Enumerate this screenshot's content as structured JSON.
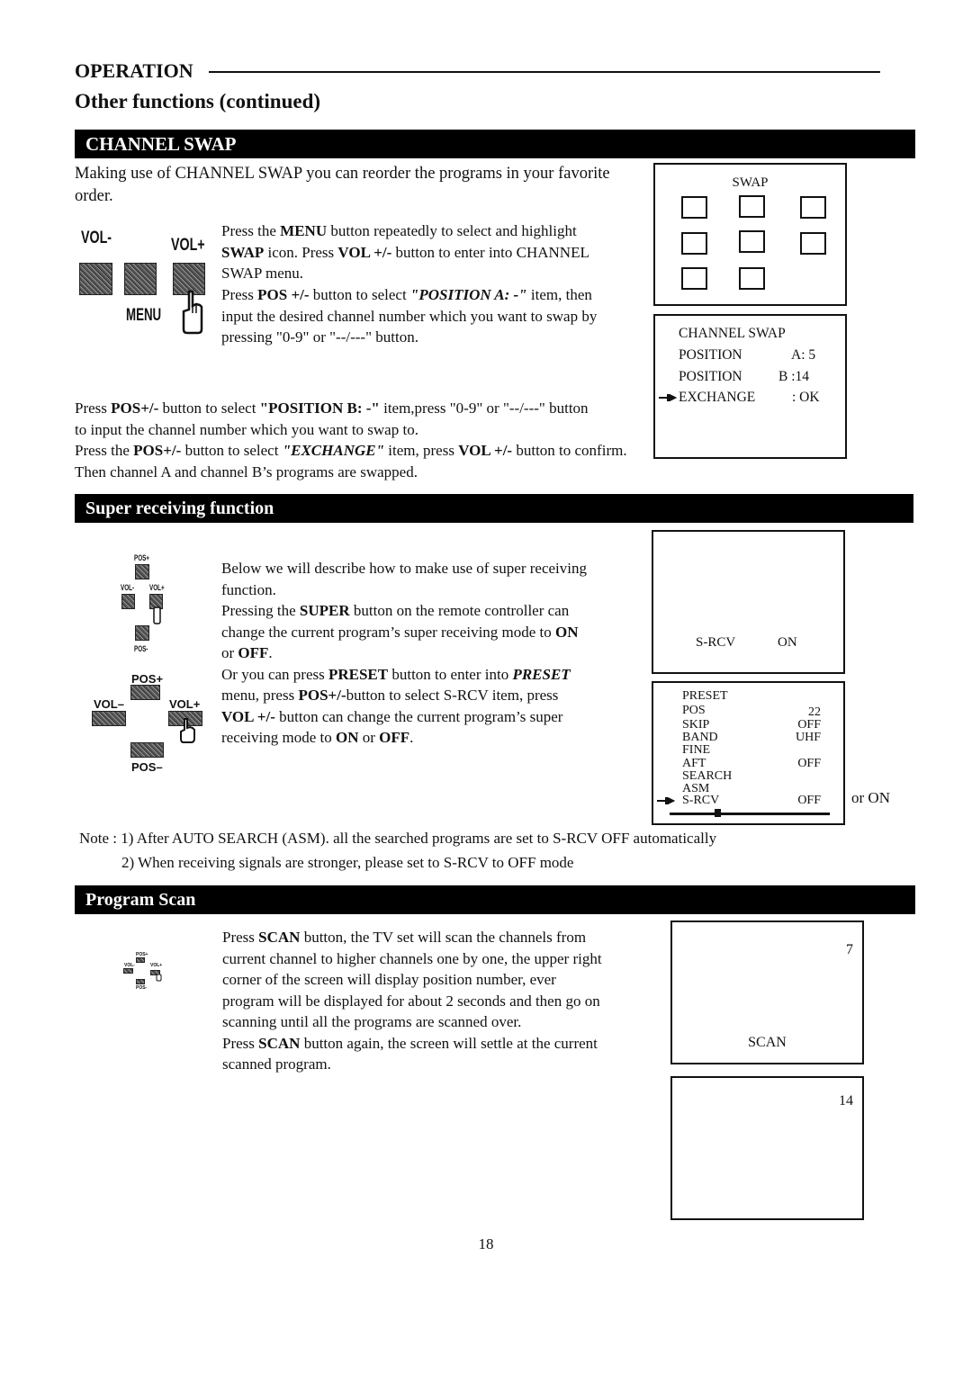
{
  "header": {
    "section": "OPERATION",
    "subtitle": "Other functions (continued)"
  },
  "channel_swap": {
    "title": "CHANNEL SWAP",
    "intro": "Making use of CHANNEL SWAP you can reorder the programs in your favorite order.",
    "step1_parts": [
      {
        "t": "Press the ",
        "s": "normal"
      },
      {
        "t": "MENU",
        "s": "bold"
      },
      {
        "t": " button repeatedly to select and highlight ",
        "s": "normal"
      },
      {
        "t": "SWAP",
        "s": "bold"
      },
      {
        "t": " icon. Press ",
        "s": "normal"
      },
      {
        "t": "VOL +/-",
        "s": "bold"
      },
      {
        "t": " button to enter into CHANNEL SWAP menu.",
        "s": "normal"
      }
    ],
    "step2_parts": [
      {
        "t": "Press ",
        "s": "normal"
      },
      {
        "t": "POS +/-",
        "s": "bold"
      },
      {
        "t": " button to select ",
        "s": "normal"
      },
      {
        "t": "\"POSITION A: -\"",
        "s": "bolditalic"
      },
      {
        "t": " item, then input the desired channel number which you want to swap by pressing \"0-9\" or \"--/---\" button.",
        "s": "normal"
      }
    ],
    "step3_parts": [
      {
        "t": "Press ",
        "s": "normal"
      },
      {
        "t": "POS+/-",
        "s": "bold"
      },
      {
        "t": " button to select ",
        "s": "normal"
      },
      {
        "t": "\"POSITION B: -\"",
        "s": "bold"
      },
      {
        "t": " item,press \"0-9\" or \"--/---\" button to input the channel number which you want to swap to.",
        "s": "normal"
      }
    ],
    "step4_parts": [
      {
        "t": "Press the ",
        "s": "normal"
      },
      {
        "t": "POS+/-",
        "s": "bold"
      },
      {
        "t": " button to select ",
        "s": "normal"
      },
      {
        "t": "\"EXCHANGE\"",
        "s": "bolditalic"
      },
      {
        "t": " item, press ",
        "s": "normal"
      },
      {
        "t": "VOL +/-",
        "s": "bold"
      },
      {
        "t": " button to confirm. Then channel A and channel B’s programs are swapped.",
        "s": "normal"
      }
    ],
    "remote": {
      "vol_minus": "VOL-",
      "vol_plus": "VOL+",
      "menu": "MENU"
    },
    "swap_screen": {
      "label": "SWAP",
      "icon_count": 8
    },
    "swap_menu": {
      "title": "CHANNEL SWAP",
      "rows": [
        {
          "label": "POSITION",
          "value": "A: 5"
        },
        {
          "label": "POSITION",
          "value": "B :14"
        },
        {
          "label": "EXCHANGE",
          "value": ": OK",
          "selected": true
        }
      ]
    }
  },
  "super_receiving": {
    "title": "Super receiving function",
    "text_parts": [
      {
        "t": "Below we will describe how to make use of super receiving function.",
        "s": "normal",
        "br": true
      },
      {
        "t": "Pressing the ",
        "s": "normal"
      },
      {
        "t": "SUPER",
        "s": "bold"
      },
      {
        "t": " button on the remote controller can change the current program’s super receiving mode to ",
        "s": "normal"
      },
      {
        "t": "ON",
        "s": "bold"
      },
      {
        "t": " or ",
        "s": "normal"
      },
      {
        "t": "OFF",
        "s": "bold"
      },
      {
        "t": ".",
        "s": "normal",
        "br": true
      },
      {
        "t": "Or you can press ",
        "s": "normal"
      },
      {
        "t": "PRESET",
        "s": "bold"
      },
      {
        "t": " button to enter into ",
        "s": "normal"
      },
      {
        "t": "PRESET",
        "s": "bolditalic"
      },
      {
        "t": "  menu, press ",
        "s": "normal"
      },
      {
        "t": "POS+/-",
        "s": "bold"
      },
      {
        "t": "button to select S-RCV item, press ",
        "s": "normal"
      },
      {
        "t": "VOL +/-",
        "s": "bold"
      },
      {
        "t": " button can change the current program’s super receiving mode to ",
        "s": "normal"
      },
      {
        "t": "ON",
        "s": "bold"
      },
      {
        "t": " or ",
        "s": "normal"
      },
      {
        "t": "OFF",
        "s": "bold"
      },
      {
        "t": ".",
        "s": "normal"
      }
    ],
    "remote_small": {
      "pos_plus": "POS+",
      "pos_minus": "POS-",
      "vol_minus": "VOL-",
      "vol_plus": "VOL+"
    },
    "remote_large": {
      "pos_plus": "POS+",
      "pos_minus": "POS–",
      "vol_minus": "VOL–",
      "vol_plus": "VOL+"
    },
    "srcv_screen": {
      "label": "S-RCV",
      "value": "ON"
    },
    "preset_menu": {
      "title": "PRESET",
      "rows": [
        {
          "label": "POS",
          "value": "22"
        },
        {
          "label": "SKIP",
          "value": "OFF"
        },
        {
          "label": "BAND",
          "value": "UHF"
        },
        {
          "label": "FINE",
          "value": ""
        },
        {
          "label": "AFT",
          "value": "OFF"
        },
        {
          "label": "SEARCH",
          "value": ""
        },
        {
          "label": "ASM",
          "value": ""
        },
        {
          "label": "S-RCV",
          "value": "OFF",
          "selected": true
        }
      ],
      "slider_level": 0.3
    },
    "or_on": "or ON",
    "notes": [
      "Note : 1) After AUTO SEARCH (ASM). all the searched programs are set to S-RCV OFF automatically",
      "2) When receiving signals are stronger, please set to S-RCV to OFF mode"
    ]
  },
  "program_scan": {
    "title": "Program Scan",
    "text_parts": [
      {
        "t": "Press ",
        "s": "normal"
      },
      {
        "t": "SCAN",
        "s": "bold"
      },
      {
        "t": " button, the TV set will scan the channels from current channel to higher channels one by one, the upper right corner of the screen will display position number, ever program will be displayed for about 2 seconds and then go on scanning until all the programs are scanned over.",
        "s": "normal",
        "br": true
      },
      {
        "t": "Press ",
        "s": "normal"
      },
      {
        "t": "SCAN",
        "s": "bold"
      },
      {
        "t": " button again, the screen will settle at the current scanned program.",
        "s": "normal"
      }
    ],
    "remote_tiny": {
      "pos_plus": "POS+",
      "pos_minus": "POS-",
      "vol_minus": "VOL-",
      "vol_plus": "VOL+"
    },
    "screen1": {
      "number": "7",
      "label": "SCAN"
    },
    "screen2": {
      "number": "14"
    }
  },
  "page_number": "18"
}
